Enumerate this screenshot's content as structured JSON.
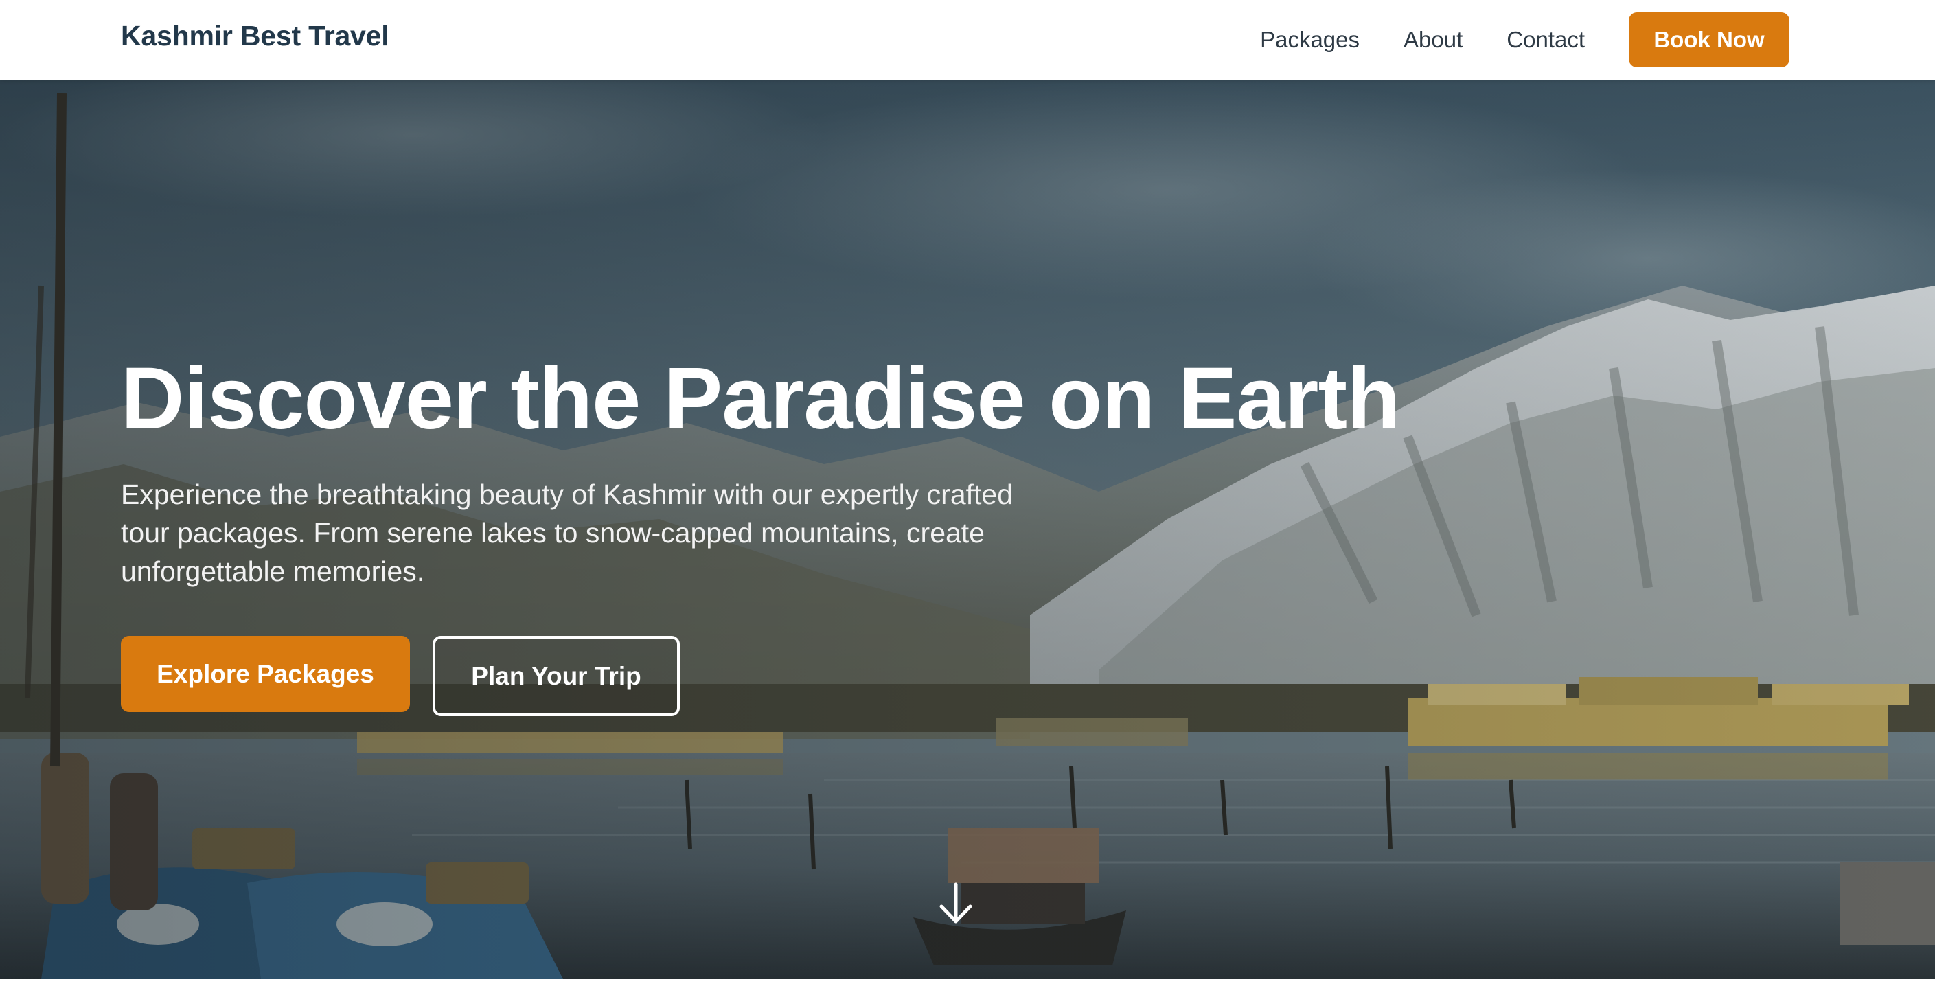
{
  "navbar": {
    "brand": "Kashmir Best Travel",
    "links": [
      "Packages",
      "About",
      "Contact"
    ],
    "cta_label": "Book Now",
    "accent_color": "#d97a0f"
  },
  "hero": {
    "title": "Discover the Paradise on Earth",
    "subtitle": "Experience the breathtaking beauty of Kashmir with our expertly crafted tour packages. From serene lakes to snow-capped mountains, create unforgettable memories.",
    "primary_button": "Explore Packages",
    "secondary_button": "Plan Your Trip",
    "scroll_icon": "arrow-down-icon",
    "background_image": "lake-houseboats-mountains"
  }
}
